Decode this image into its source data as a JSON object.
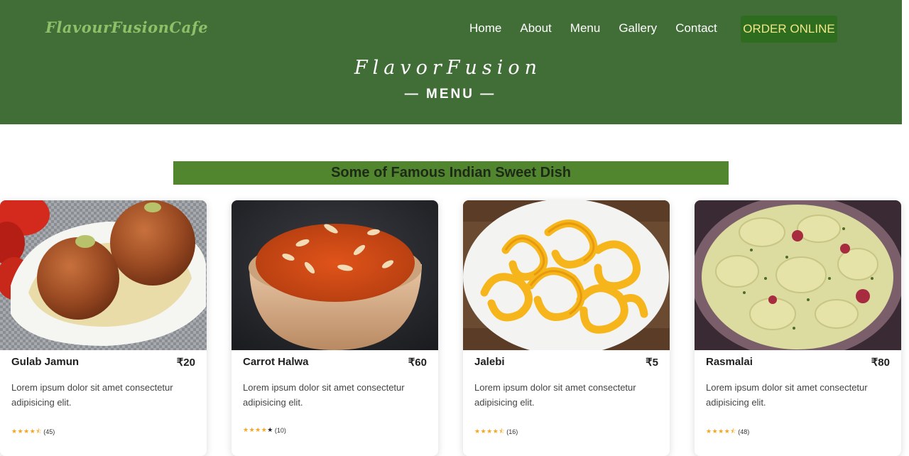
{
  "header": {
    "logo": "FlavourFusionCafe",
    "nav": [
      "Home",
      "About",
      "Menu",
      "Gallery",
      "Contact"
    ],
    "order_button": "ORDER ONLINE",
    "brand": "FlavorFusion",
    "subtitle": "— MENU —"
  },
  "section": {
    "title": "Some of Famous Indian Sweet Dish"
  },
  "cards": [
    {
      "name": "Gulab Jamun",
      "price": "₹20",
      "desc": "Lorem ipsum dolor sit amet consectetur adipisicing elit.",
      "stars": "★★★★⯪",
      "reviews": "(45)"
    },
    {
      "name": "Carrot Halwa",
      "price": "₹60",
      "desc": "Lorem ipsum dolor sit amet consectetur adipisicing elit.",
      "stars": "★★★★",
      "stars_empty": "★",
      "reviews": "(10)"
    },
    {
      "name": "Jalebi",
      "price": "₹5",
      "desc": "Lorem ipsum dolor sit amet consectetur adipisicing elit.",
      "stars": "★★★★⯪",
      "reviews": "(16)"
    },
    {
      "name": "Rasmalai",
      "price": "₹80",
      "desc": "Lorem ipsum dolor sit amet consectetur adipisicing elit.",
      "stars": "★★★★⯪",
      "reviews": "(48)"
    }
  ],
  "colors": {
    "header_bg": "#416d37",
    "banner_bg": "#51862f",
    "order_bg": "#2e6d1f",
    "star": "#f5a623"
  }
}
